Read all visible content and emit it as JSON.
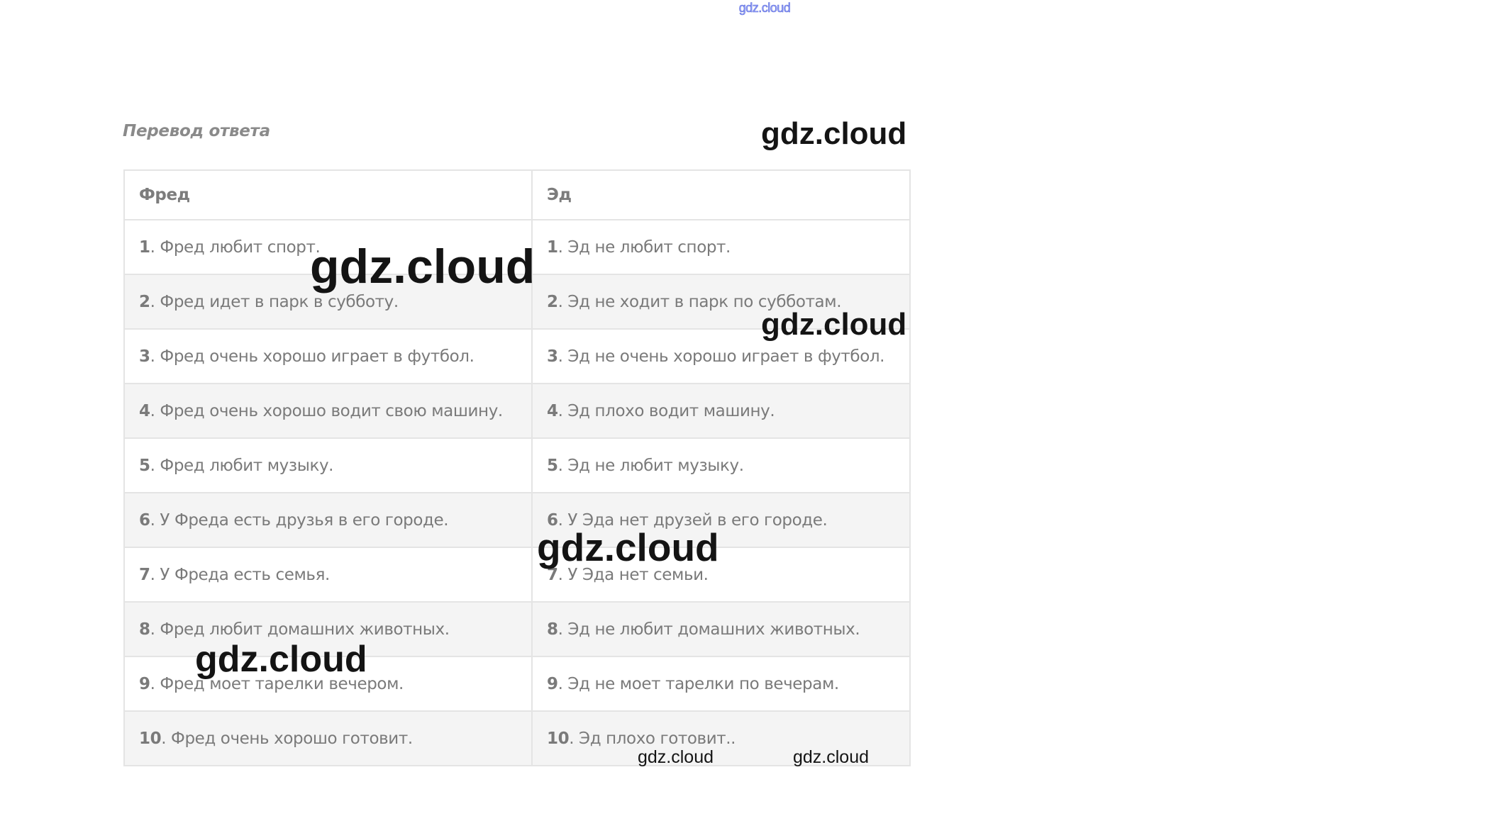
{
  "watermarks": {
    "top": "gdz.cloud",
    "w1": "gdz.cloud",
    "w2": "gdz.cloud",
    "w3": "gdz.cloud",
    "w4": "gdz.cloud",
    "w5": "gdz.cloud",
    "w6": "gdz.cloud",
    "w7": "gdz.cloud"
  },
  "heading": "Перевод ответа",
  "table": {
    "headers": [
      "Фред",
      "Эд"
    ],
    "rows": [
      [
        {
          "num": "1",
          "text": ". Фред любит спорт."
        },
        {
          "num": "1",
          "text": ". Эд не любит спорт."
        }
      ],
      [
        {
          "num": "2",
          "text": ". Фред идет в парк в субботу."
        },
        {
          "num": "2",
          "text": ". Эд не ходит в парк по субботам."
        }
      ],
      [
        {
          "num": "3",
          "text": ". Фред очень хорошо играет в футбол."
        },
        {
          "num": "3",
          "text": ". Эд не очень хорошо играет в футбол."
        }
      ],
      [
        {
          "num": "4",
          "text": ". Фред очень хорошо водит свою машину."
        },
        {
          "num": "4",
          "text": ". Эд плохо водит машину."
        }
      ],
      [
        {
          "num": "5",
          "text": ". Фред любит музыку."
        },
        {
          "num": "5",
          "text": ". Эд не любит музыку."
        }
      ],
      [
        {
          "num": "6",
          "text": ". У Фреда есть друзья в его городе."
        },
        {
          "num": "6",
          "text": ". У Эда нет друзей в его городе."
        }
      ],
      [
        {
          "num": "7",
          "text": ". У Фреда есть семья."
        },
        {
          "num": "7",
          "text": ". У Эда нет семьи."
        }
      ],
      [
        {
          "num": "8",
          "text": ". Фред любит домашних животных."
        },
        {
          "num": "8",
          "text": ". Эд не любит домашних животных."
        }
      ],
      [
        {
          "num": "9",
          "text": ". Фред моет тарелки вечером."
        },
        {
          "num": "9",
          "text": ". Эд не моет тарелки по вечерам."
        }
      ],
      [
        {
          "num": "10",
          "text": ". Фред очень хорошо готовит."
        },
        {
          "num": "10",
          "text": ". Эд плохо готовит.."
        }
      ]
    ]
  }
}
